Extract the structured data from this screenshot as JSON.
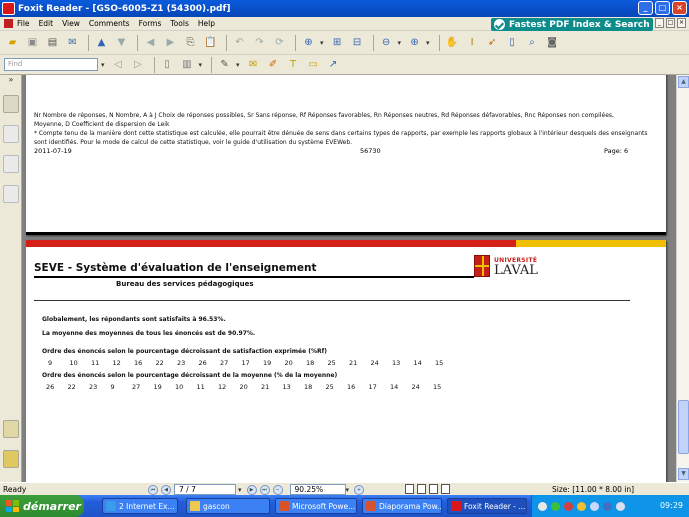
{
  "window": {
    "title": "Foxit Reader - [GSO-6005-Z1 (54300).pdf]",
    "buttons": [
      "_",
      "□",
      "×"
    ]
  },
  "menu": {
    "items": [
      "File",
      "Edit",
      "View",
      "Comments",
      "Forms",
      "Tools",
      "Help"
    ],
    "promo": "Fastest PDF Index & Search"
  },
  "toolbar": {
    "find_placeholder": "Find"
  },
  "page_prev": {
    "legend_line1": "Nr  Nombre de réponses, N  Nombre, A à J  Choix de réponses possibles, Sr  Sans réponse, Rf  Réponses favorables, Rn  Réponses neutres, Rd  Réponses défavorables, Rnc  Réponses non compilées,",
    "legend_line2": "  Moyenne, D  Coefficient de dispersion de Leik",
    "legend_line3": "* Compte tenu de la manière dont cette statistique est calculée, elle pourrait être dénuée de sens dans certains types de rapports, par exemple les rapports globaux à l'intérieur desquels des enseignants",
    "legend_line4": "sont identifiés.  Pour le mode de calcul de cette statistique, voir le guide d'utilisation du système EVEWeb.",
    "footer_date": "2011-07-19",
    "footer_id": "56730",
    "footer_page": "Page: 6"
  },
  "page": {
    "header_title": "SEVE - Système d'évaluation de l'enseignement",
    "header_subtitle": "Bureau des services pédagogiques",
    "logo_university": "UNIVERSITÉ",
    "logo_name": "LAVAL",
    "line1": "Globalement, les répondants sont satisfaits à 96.53%.",
    "line2": "La moyenne des moyennes de tous les énoncés est de 90.97%.",
    "order1_title": "Ordre des énoncés selon le pourcentage décroissant de satisfaction exprimée (%Rf)",
    "order1_values": [
      "9",
      "10",
      "11",
      "12",
      "16",
      "22",
      "23",
      "26",
      "27",
      "17",
      "19",
      "20",
      "18",
      "25",
      "21",
      "24",
      "13",
      "14",
      "15"
    ],
    "order2_title": "Ordre des énoncés selon le pourcentage décroissant de la moyenne (% de la moyenne)",
    "order2_values": [
      "26",
      "22",
      "23",
      "9",
      "27",
      "19",
      "10",
      "11",
      "12",
      "20",
      "21",
      "13",
      "18",
      "25",
      "16",
      "17",
      "14",
      "24",
      "15"
    ]
  },
  "status": {
    "ready": "Ready",
    "page": "7 / 7",
    "zoom": "90.25%",
    "size": "Size: [11.00 * 8.00 in]"
  },
  "taskbar": {
    "start": "démarrer",
    "tasks": [
      "2 Internet Ex...",
      "gascon",
      "Microsoft Powe...",
      "Diaporama Pow...",
      "Foxit Reader - ..."
    ],
    "clock": "09:29"
  }
}
